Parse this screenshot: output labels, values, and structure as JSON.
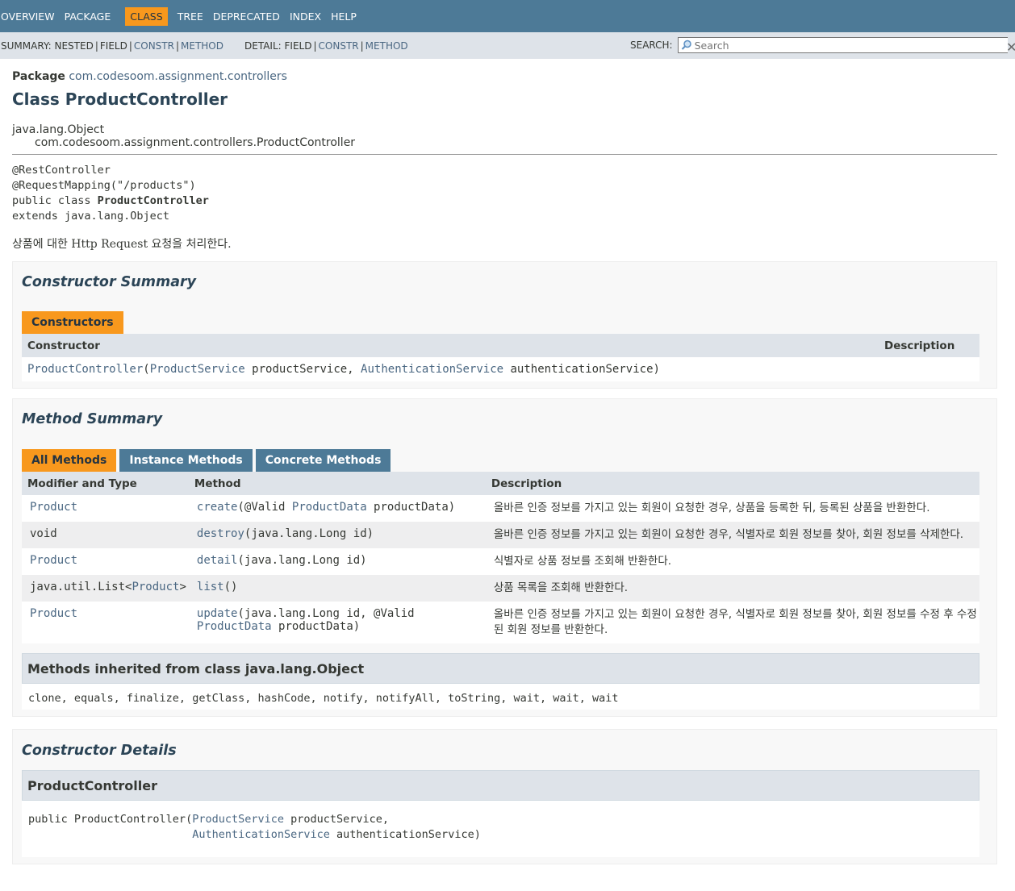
{
  "topnav": {
    "items": [
      "OVERVIEW",
      "PACKAGE",
      "CLASS",
      "TREE",
      "DEPRECATED",
      "INDEX",
      "HELP"
    ],
    "active": "CLASS"
  },
  "subnav": {
    "summary_label": "SUMMARY:",
    "summary_items": [
      "NESTED",
      "FIELD",
      "CONSTR",
      "METHOD"
    ],
    "detail_label": "DETAIL:",
    "detail_items": [
      "FIELD",
      "CONSTR",
      "METHOD"
    ],
    "search_label": "SEARCH:",
    "search_placeholder": "Search"
  },
  "header": {
    "package_label": "Package",
    "package_name": "com.codesoom.assignment.controllers",
    "title": "Class ProductController",
    "inherit_root": "java.lang.Object",
    "inherit_child": "com.codesoom.assignment.controllers.ProductController"
  },
  "signature": {
    "line1": "@RestController",
    "line2": "@RequestMapping(\"/products\")",
    "line3_prefix": "public class ",
    "line3_name": "ProductController",
    "line4": "extends java.lang.Object"
  },
  "class_description": "상품에 대한 Http Request 요청을 처리한다.",
  "constructor_summary": {
    "heading": "Constructor Summary",
    "tab": "Constructors",
    "col_constructor": "Constructor",
    "col_description": "Description",
    "row": {
      "name": "ProductController",
      "open": "(",
      "type1": "ProductService",
      "param1": " productService, ",
      "type2": "AuthenticationService",
      "param2": " authenticationService)"
    }
  },
  "method_summary": {
    "heading": "Method Summary",
    "tabs": [
      "All Methods",
      "Instance Methods",
      "Concrete Methods"
    ],
    "col_modifier": "Modifier and Type",
    "col_method": "Method",
    "col_description": "Description",
    "rows": [
      {
        "type": "Product",
        "name": "create",
        "args_pre": "(@Valid ",
        "arg_link": "ProductData",
        "args_post": " productData)",
        "desc": "올바른 인증 정보를 가지고 있는 회원이 요청한 경우, 상품을 등록한 뒤, 등록된 상품을 반환한다."
      },
      {
        "type": "void",
        "name": "destroy",
        "args_pre": "(java.lang.Long id)",
        "arg_link": "",
        "args_post": "",
        "desc": "올바른 인증 정보를 가지고 있는 회원이 요청한 경우, 식별자로 회원 정보를 찾아, 회원 정보를 삭제한다."
      },
      {
        "type": "Product",
        "name": "detail",
        "args_pre": "(java.lang.Long id)",
        "arg_link": "",
        "args_post": "",
        "desc": "식별자로 상품 정보를 조회해 반환한다."
      },
      {
        "type_pre": "java.util.List<",
        "type": "Product",
        "type_post": ">",
        "name": "list",
        "args_pre": "()",
        "arg_link": "",
        "args_post": "",
        "desc": "상품 목록을 조회해 반환한다."
      },
      {
        "type": "Product",
        "name": "update",
        "args_pre": "(java.lang.Long id, @Valid",
        "arg_link": "ProductData",
        "args_post": " productData)",
        "desc": "올바른 인증 정보를 가지고 있는 회원이 요청한 경우, 식별자로 회원 정보를 찾아, 회원 정보를 수정 후 수정 된 회원 정보를 반환한다."
      }
    ],
    "inherited_title": "Methods inherited from class java.lang.Object",
    "inherited_list": "clone, equals, finalize, getClass, hashCode, notify, notifyAll, toString, wait, wait, wait"
  },
  "constructor_details": {
    "heading": "Constructor Details",
    "name": "ProductController",
    "sig_prefix": "public ProductController(",
    "type1": "ProductService",
    "param1": " productService,",
    "indent": "                         ",
    "type2": "AuthenticationService",
    "param2": " authenticationService)"
  }
}
